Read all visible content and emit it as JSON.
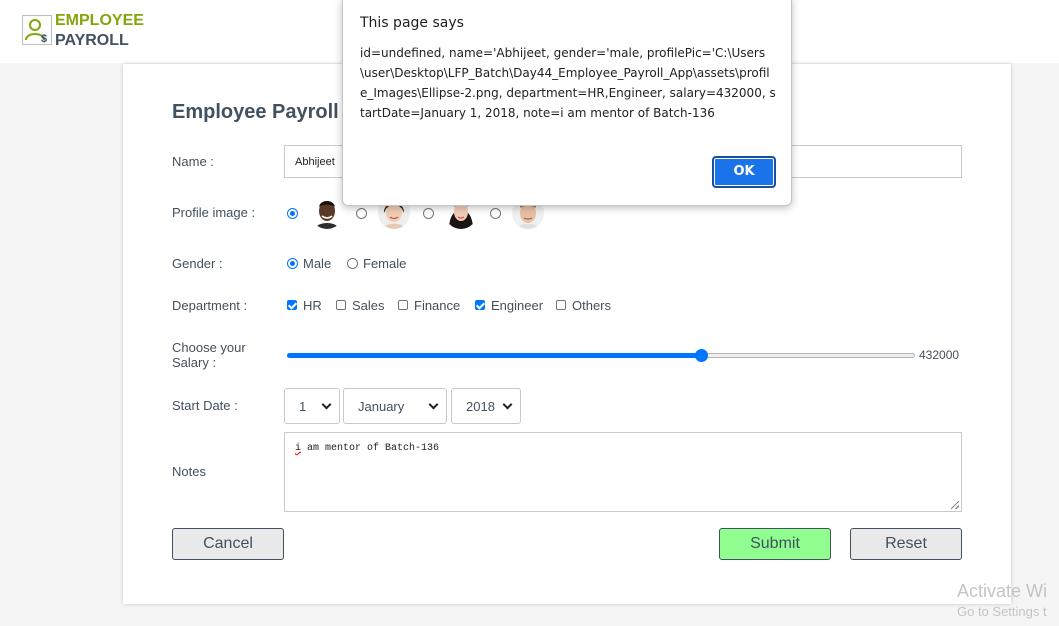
{
  "header": {
    "logo_line1": "EMPLOYEE",
    "logo_line2": "PAYROLL",
    "logo_icon": "person-dollar-icon"
  },
  "form": {
    "title": "Employee Payroll Fo",
    "name_label": "Name :",
    "name_value": "Abhijeet",
    "profile_label": "Profile image :",
    "profile_options": [
      {
        "icon": "avatar-man-1",
        "checked": true
      },
      {
        "icon": "avatar-woman-1",
        "checked": false
      },
      {
        "icon": "avatar-woman-2",
        "checked": false
      },
      {
        "icon": "avatar-man-2",
        "checked": false
      }
    ],
    "gender_label": "Gender :",
    "gender_options": [
      {
        "label": "Male",
        "checked": true
      },
      {
        "label": "Female",
        "checked": false
      }
    ],
    "department_label": "Department :",
    "department_options": [
      {
        "label": "HR",
        "checked": true
      },
      {
        "label": "Sales",
        "checked": false
      },
      {
        "label": "Finance",
        "checked": false
      },
      {
        "label": "Engineer",
        "checked": true
      },
      {
        "label": "Others",
        "checked": false
      }
    ],
    "salary_label": "Choose your Salary :",
    "salary_value": "432000",
    "salary_fraction": 0.66,
    "start_date_label": "Start Date :",
    "start_day": "1",
    "start_month": "January",
    "start_year": "2018",
    "notes_label": "Notes",
    "notes_first_word": "i",
    "notes_rest": " am mentor of Batch-136",
    "cancel_label": "Cancel",
    "submit_label": "Submit",
    "reset_label": "Reset"
  },
  "dialog": {
    "title": "This page says",
    "message": "id=undefined, name='Abhijeet, gender='male, profilePic='C:\\Users\\user\\Desktop\\LFP_Batch\\Day44_Employee_Payroll_App\\assets\\profile_Images\\Ellipse-2.png, department=HR,Engineer, salary=432000, startDate=January 1, 2018, note=i am mentor of Batch-136",
    "ok_label": "OK"
  },
  "watermark": {
    "line1": "Activate Wi",
    "line2": "Go to Settings t"
  },
  "colors": {
    "brand_green": "#82a70c",
    "brand_dark": "#42515f",
    "accent_blue": "#0075ff",
    "submit_green": "#90ff90",
    "dialog_ok_blue": "#1a73e8"
  }
}
